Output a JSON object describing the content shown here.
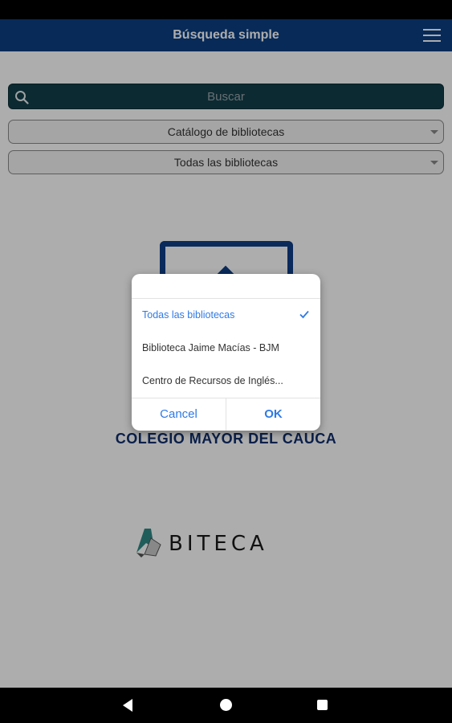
{
  "app_bar": {
    "title": "Búsqueda simple",
    "menu_icon": "hamburger-menu-icon"
  },
  "search": {
    "placeholder": "Buscar",
    "icon": "search-icon"
  },
  "catalog_select": {
    "selected": "Catálogo de bibliotecas"
  },
  "library_select": {
    "selected": "Todas las bibliotecas"
  },
  "branding": {
    "college_name": "COLEGIO MAYOR DEL CAUCA",
    "vendor_logo_text": "BITECA"
  },
  "dialog": {
    "options": [
      {
        "label": "Todas las bibliotecas",
        "selected": true
      },
      {
        "label": "Biblioteca Jaime Macías - BJM",
        "selected": false
      },
      {
        "label": "Centro de Recursos de Inglés...",
        "selected": false
      }
    ],
    "cancel_label": "Cancel",
    "ok_label": "OK"
  },
  "nav_bar": {
    "back_icon": "back-icon",
    "home_icon": "home-icon",
    "recents_icon": "recents-icon"
  },
  "colors": {
    "app_bar": "#0b3f82",
    "accent": "#2f7ae5",
    "search_bg": "#123e4a"
  }
}
